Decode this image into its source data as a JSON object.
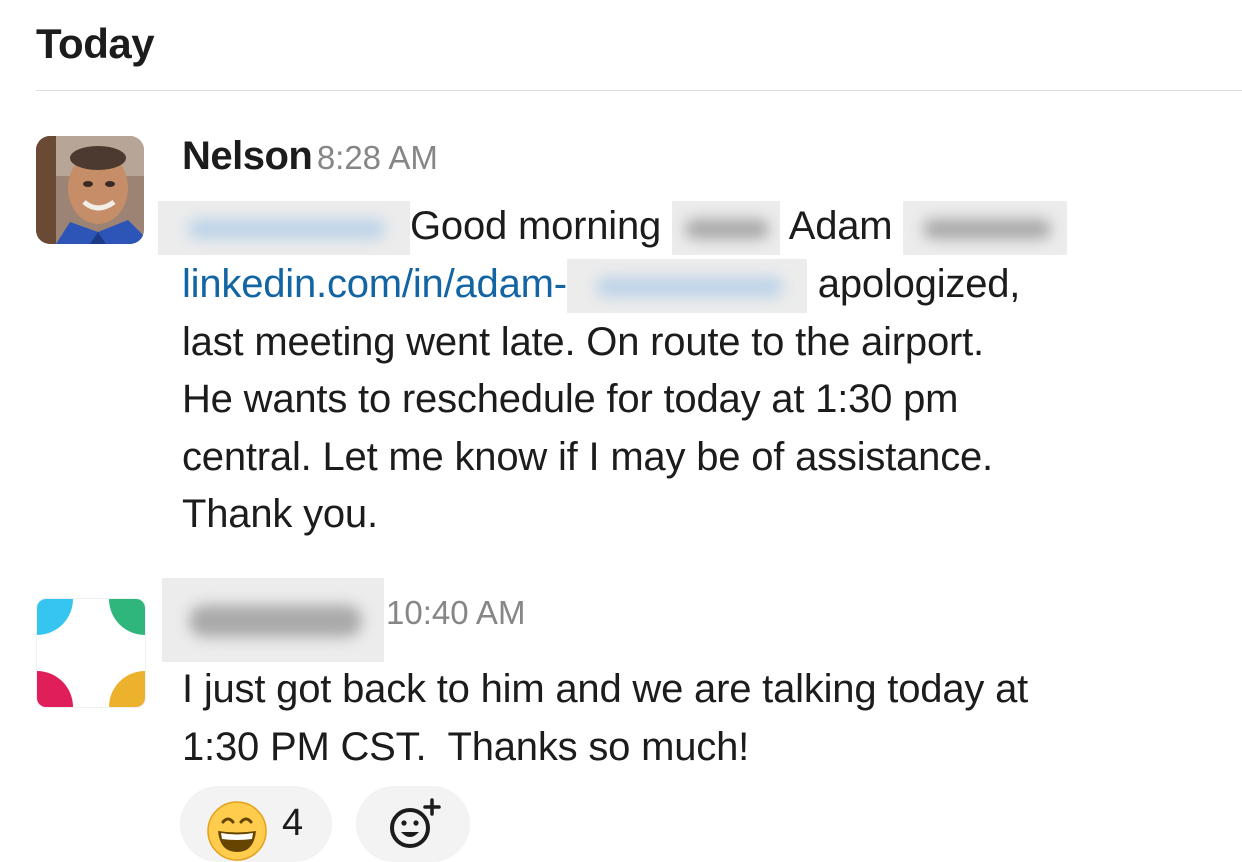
{
  "day_header": "Today",
  "messages": [
    {
      "author": "Nelson",
      "time": "8:28 AM",
      "lines": {
        "l1_a": "Good morning",
        "l1_b": "Adam",
        "l2_link": "linkedin.com/in/adam-",
        "l2_b": "apologized,",
        "l3": "last meeting went late. On route to the airport.",
        "l4": "He wants to reschedule for today at 1:30 pm",
        "l5": "central. Let me know if I may be of assistance.",
        "l6": "Thank you."
      }
    },
    {
      "author": "",
      "time": "10:40 AM",
      "lines": {
        "l1": "I just got back to him and we are talking today at",
        "l2": "1:30 PM CST.  Thanks so much!"
      }
    }
  ],
  "reactions": [
    {
      "emoji": "grinning-face-with-smiling-eyes",
      "count": "4"
    },
    {
      "emoji": "add-reaction-icon"
    }
  ],
  "colors": {
    "link": "#1264a3",
    "timestamp": "#868686",
    "logo_blue": "#36c5f0",
    "logo_green": "#2eb67d",
    "logo_red": "#e01e5a",
    "logo_yellow": "#ecb22e"
  }
}
